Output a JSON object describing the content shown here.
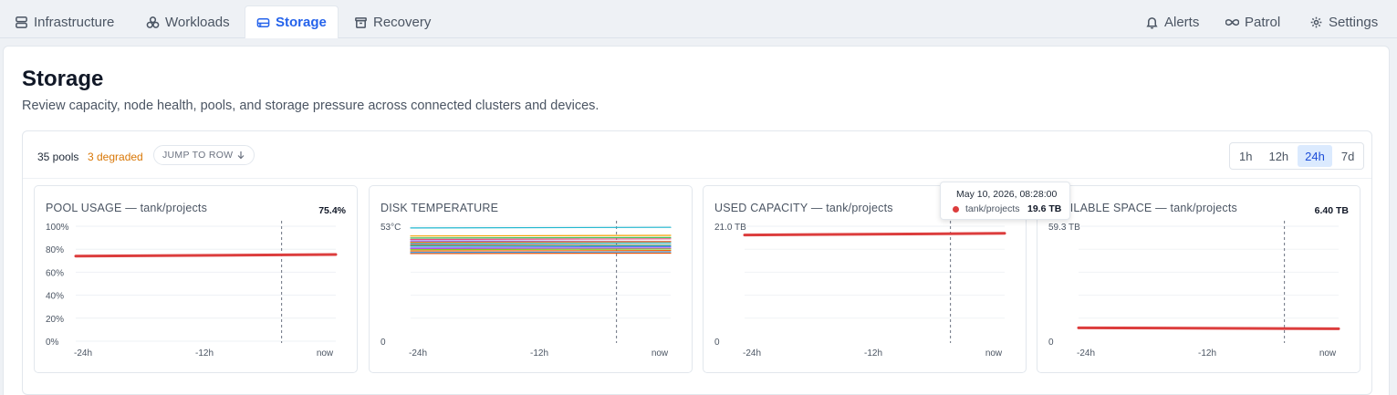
{
  "nav": {
    "tabs": [
      {
        "label": "Infrastructure",
        "icon": "server-stack-icon"
      },
      {
        "label": "Workloads",
        "icon": "cubes-icon"
      },
      {
        "label": "Storage",
        "icon": "hard-drive-icon",
        "active": true
      },
      {
        "label": "Recovery",
        "icon": "archive-box-icon"
      }
    ],
    "right_tabs": [
      {
        "label": "Alerts",
        "icon": "bell-icon"
      },
      {
        "label": "Patrol",
        "icon": "infinity-icon"
      },
      {
        "label": "Settings",
        "icon": "gear-icon"
      }
    ]
  },
  "page": {
    "title": "Storage",
    "subtitle": "Review capacity, node health, pools, and storage pressure across connected clusters and devices."
  },
  "toolbar": {
    "pools_count": "35 pools",
    "degraded": "3 degraded",
    "jump_label": "JUMP TO ROW",
    "ranges": [
      "1h",
      "12h",
      "24h",
      "7d"
    ],
    "active_range": "24h"
  },
  "colors": {
    "accent": "#2563eb",
    "degraded": "#d97706",
    "series_red": "#dc3d3d"
  },
  "cards": [
    {
      "title": "POOL USAGE",
      "sub": "— tank/projects",
      "value": "75.4%"
    },
    {
      "title": "DISK TEMPERATURE",
      "sub": "",
      "value": ""
    },
    {
      "title": "USED CAPACITY",
      "sub": "— tank/projects",
      "value": ""
    },
    {
      "title": "AVAILABLE SPACE",
      "sub": "— tank/projects",
      "value": "6.40 TB"
    }
  ],
  "tooltip": {
    "date": "May 10, 2026, 08:28:00",
    "series": "tank/projects",
    "value": "19.6 TB"
  },
  "chart_data": [
    {
      "type": "line",
      "title": "POOL USAGE — tank/projects",
      "x": [
        "-24h",
        "now"
      ],
      "xticks": [
        "-24h",
        "-12h",
        "now"
      ],
      "yticks": [
        "0%",
        "20%",
        "40%",
        "60%",
        "80%",
        "100%"
      ],
      "ylim": [
        0,
        100
      ],
      "series": [
        {
          "name": "tank/projects",
          "values": [
            74,
            75.4
          ]
        }
      ],
      "cursor": "-5h"
    },
    {
      "type": "line",
      "title": "DISK TEMPERATURE",
      "xticks": [
        "-24h",
        "-12h",
        "now"
      ],
      "yticks": [
        "0",
        "53°C"
      ],
      "ylim": [
        0,
        53
      ],
      "series": [
        {
          "values": [
            52.2,
            52.5
          ]
        },
        {
          "values": [
            48.5,
            48.8
          ]
        },
        {
          "values": [
            47.6,
            47.8
          ]
        },
        {
          "values": [
            46.9,
            47.2
          ]
        },
        {
          "values": [
            46.2,
            46.0
          ]
        },
        {
          "values": [
            45.6,
            45.9
          ]
        },
        {
          "values": [
            45.0,
            45.3
          ]
        },
        {
          "values": [
            44.5,
            44.3
          ]
        },
        {
          "values": [
            44.0,
            44.2
          ]
        },
        {
          "values": [
            43.3,
            43.6
          ]
        },
        {
          "values": [
            42.7,
            42.9
          ]
        },
        {
          "values": [
            42.2,
            42.5
          ]
        },
        {
          "values": [
            41.6,
            41.8
          ]
        },
        {
          "values": [
            40.9,
            41.2
          ]
        },
        {
          "values": [
            40.4,
            40.6
          ]
        }
      ],
      "cursor": "-5h"
    },
    {
      "type": "line",
      "title": "USED CAPACITY — tank/projects",
      "xticks": [
        "-24h",
        "-12h",
        "now"
      ],
      "yticks": [
        "0",
        "21.0 TB"
      ],
      "ylim": [
        0,
        21.0
      ],
      "series": [
        {
          "name": "tank/projects",
          "values": [
            19.4,
            19.7
          ]
        }
      ],
      "cursor": "-5h"
    },
    {
      "type": "line",
      "title": "AVAILABLE SPACE — tank/projects",
      "xticks": [
        "-24h",
        "-12h",
        "now"
      ],
      "yticks": [
        "0",
        "59.3 TB"
      ],
      "ylim": [
        0,
        59.3
      ],
      "series": [
        {
          "name": "tank/projects",
          "values": [
            6.9,
            6.4
          ]
        }
      ],
      "cursor": "-5h"
    }
  ]
}
